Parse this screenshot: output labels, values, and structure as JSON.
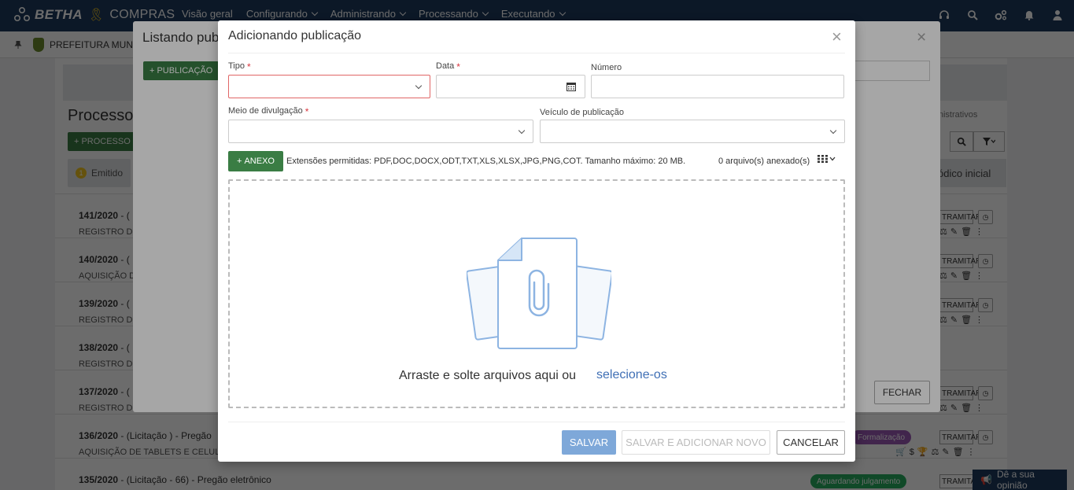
{
  "topbar": {
    "brand_name": "BETHA",
    "brand_product": "COMPRAS",
    "nav": [
      {
        "label": "Visão geral",
        "dropdown": false
      },
      {
        "label": "Configurando",
        "dropdown": true
      },
      {
        "label": "Administrando",
        "dropdown": true
      },
      {
        "label": "Processando",
        "dropdown": true
      },
      {
        "label": "Executando",
        "dropdown": true
      }
    ],
    "icons": [
      "headset-icon",
      "search-icon",
      "gear-cluster-icon",
      "bell-icon",
      "user-icon"
    ]
  },
  "entity_bar": {
    "entity_name": "PREFEITURA MUN"
  },
  "background_page": {
    "title": "Processo",
    "new_process_label": "PROCESSO",
    "emitidos_tab": "Emitido",
    "emitidos_count": "1",
    "right_label": "administrativos",
    "inicial_label": "ódico inicial",
    "rows": [
      {
        "number": "141/2020",
        "rest": " - (",
        "subtitle": "REGISTRO DE"
      },
      {
        "number": "140/2020",
        "rest": " - (",
        "subtitle": "AQUISIÇÃO D"
      },
      {
        "number": "139/2020",
        "rest": " - (",
        "subtitle": "REGISTRO DE"
      },
      {
        "number": "138/2020",
        "rest": " - (",
        "subtitle": "REGISTRO DE"
      },
      {
        "number": "137/2020",
        "rest": " - (",
        "subtitle": "REGISTRO DE"
      },
      {
        "number": "136/2020",
        "rest": " - (Licitação ) - Pregão",
        "subtitle": "AQUISIÇÃO DE TABLETS E CELULAR",
        "badge": "Formalização"
      },
      {
        "number": "135/2020",
        "rest": " - (Licitação - 66) - Pregão eletrônico",
        "subtitle": "",
        "badge": "Aguardando julgamento"
      }
    ],
    "tramitar_label": "TRAMITAR",
    "feedback_label": "Dê a sua opinião"
  },
  "list_modal": {
    "title": "Listando pub",
    "new_label": "PUBLICAÇÃO",
    "close_label": "Fechar",
    "fechar_label": "FECHAR"
  },
  "form_modal": {
    "title": "Adicionando publicação",
    "fields": {
      "tipo": {
        "label": "Tipo",
        "value": ""
      },
      "data": {
        "label": "Data",
        "value": ""
      },
      "numero": {
        "label": "Número",
        "value": ""
      },
      "meio": {
        "label": "Meio de divulgação",
        "value": ""
      },
      "veiculo": {
        "label": "Veículo de publicação",
        "value": ""
      }
    },
    "anexo_label": "ANEXO",
    "extensions_info": "Extensões permitidas: PDF,DOC,DOCX,ODT,TXT,XLS,XLSX,JPG,PNG,COT. Tamanho máximo: 20 MB.",
    "attached_count": "0 arquivo(s) anexado(s)",
    "dropzone_text": "Arraste e solte arquivos aqui ou",
    "dropzone_link": "selecione-os",
    "buttons": {
      "salvar": "SALVAR",
      "salvar_novo": "SALVAR E ADICIONAR NOVO",
      "cancelar": "CANCELAR"
    }
  },
  "colors": {
    "topbar": "#1e3a5f",
    "primary_green": "#3a7d44",
    "salvar_blue": "#7ea8d9",
    "link_blue": "#3f6fb5",
    "required_red": "#d9363e",
    "badge_purple": "#9b59b6",
    "badge_green": "#27ae60"
  }
}
